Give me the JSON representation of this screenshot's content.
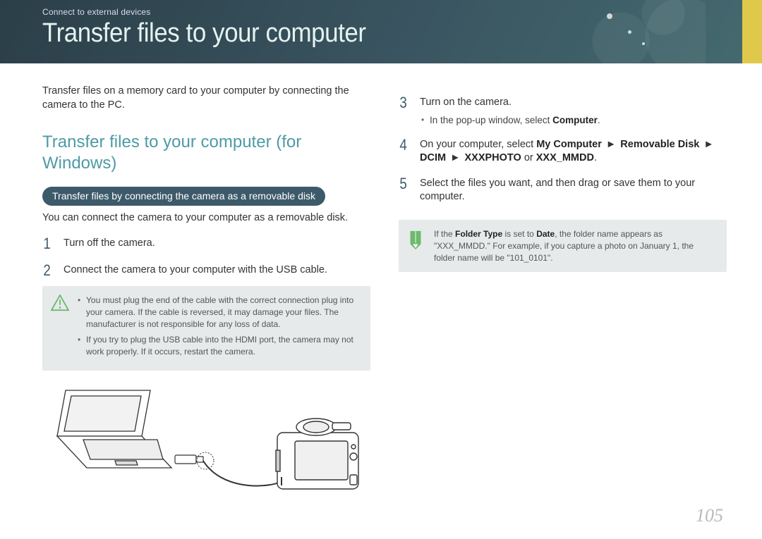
{
  "header": {
    "breadcrumb": "Connect to external devices",
    "title": "Transfer files to your computer"
  },
  "left": {
    "intro": "Transfer files on a memory card to your computer by connecting the camera to the PC.",
    "subhead": "Transfer files to your computer (for Windows)",
    "pill": "Transfer files by connecting the camera as a removable disk",
    "pill_sub": "You can connect the camera to your computer as a removable disk.",
    "step1_num": "1",
    "step1_text": "Turn off the camera.",
    "step2_num": "2",
    "step2_text": "Connect the camera to your computer with the USB cable.",
    "warn_items": [
      "You must plug the end of the cable with the correct connection plug into your camera. If the cable is reversed, it may damage your files. The manufacturer is not responsible for any loss of data.",
      "If you try to plug the USB cable into the HDMI port, the camera may not work properly. If it occurs, restart the camera."
    ]
  },
  "right": {
    "step3_num": "3",
    "step3_text": "Turn on the camera.",
    "step3_bullet_pre": "In the pop-up window, select ",
    "step3_bullet_bold": "Computer",
    "step3_bullet_post": ".",
    "step4_num": "4",
    "step4_pre": "On your computer, select ",
    "step4_path1": "My Computer",
    "step4_path2": "Removable Disk",
    "step4_path3": "DCIM",
    "step4_path4": "XXXPHOTO",
    "step4_or": " or ",
    "step4_path5": "XXX_MMDD",
    "step4_end": ".",
    "step5_num": "5",
    "step5_text": "Select the files you want, and then drag or save them to your computer.",
    "info_pre": "If the ",
    "info_b1": "Folder Type",
    "info_mid1": " is set to ",
    "info_b2": "Date",
    "info_mid2": ", the folder name appears as \"XXX_MMDD.\" For example, if you capture a photo on January 1, the folder name will be \"101_0101\"."
  },
  "page_number": "105"
}
